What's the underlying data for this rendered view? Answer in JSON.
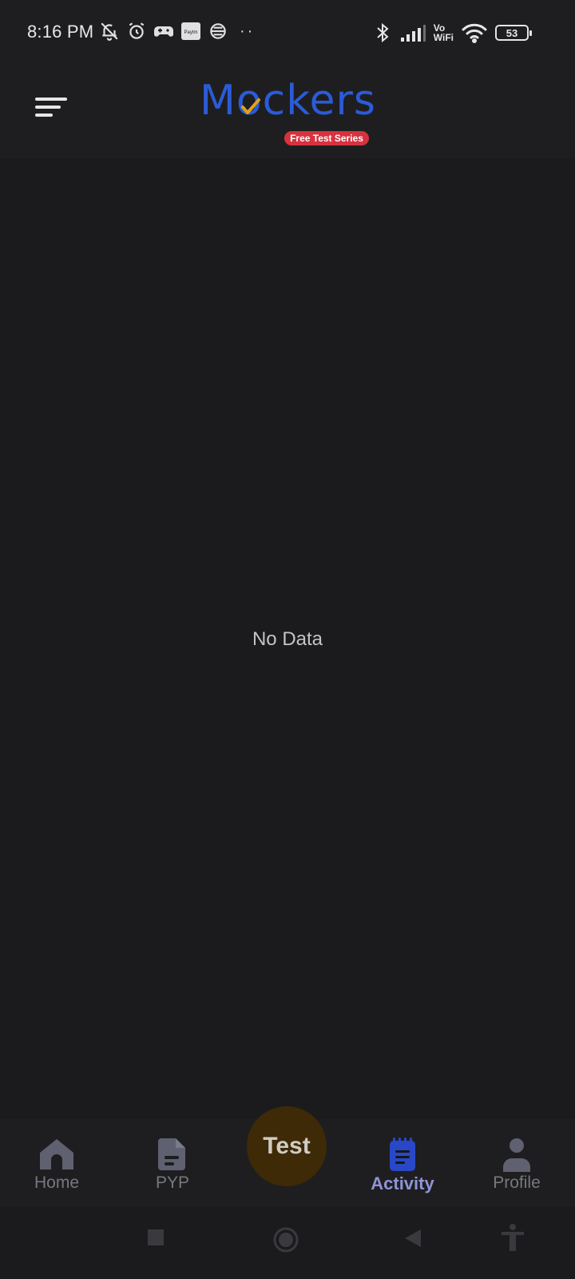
{
  "status_bar": {
    "time": "8:16 PM",
    "left_icons": [
      "bell-off-icon",
      "alarm-icon",
      "game-controller-icon",
      "paytm-icon",
      "vpn-icon"
    ],
    "more_dots": "··",
    "right_icons": [
      "bluetooth-icon",
      "signal-icon",
      "vowifi-icon",
      "wifi-icon",
      "battery-icon"
    ],
    "vowifi_line1": "Vo",
    "vowifi_line2": "WiFi",
    "paytm_label": "Paytm",
    "battery_level": "53"
  },
  "header": {
    "menu_icon": "menu-icon",
    "logo_text": "Mockers",
    "logo_tagline": "Free Test Series",
    "colors": {
      "logo_blue": "#2b5bd7",
      "badge_red": "#d7323f",
      "check_yellow": "#e0a21a"
    }
  },
  "main": {
    "empty_message": "No Data"
  },
  "bottom_nav": {
    "items": [
      {
        "label": "Home",
        "icon": "home-icon",
        "active": false
      },
      {
        "label": "PYP",
        "icon": "document-icon",
        "active": false
      },
      {
        "label": "Activity",
        "icon": "notepad-icon",
        "active": true
      },
      {
        "label": "Profile",
        "icon": "person-icon",
        "active": false
      }
    ],
    "center_button": {
      "label": "Test"
    },
    "colors": {
      "active": "#8f94d7",
      "inactive": "#77787e",
      "fab_bg": "#3e2a06"
    }
  },
  "system_nav": {
    "buttons": [
      "recents-square-icon",
      "home-circle-icon",
      "back-triangle-icon",
      "accessibility-icon"
    ]
  }
}
